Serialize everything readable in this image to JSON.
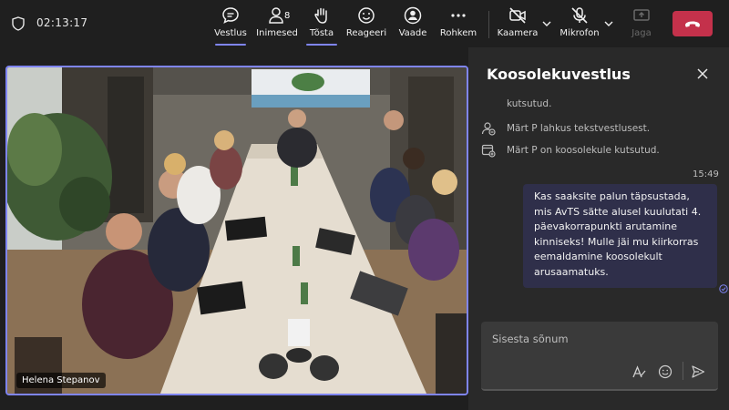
{
  "meeting": {
    "timer": "02:13:17"
  },
  "toolbar": {
    "chat_label": "Vestlus",
    "people_label": "Inimesed",
    "people_count": "8",
    "raise_label": "Tõsta",
    "react_label": "Reageeri",
    "view_label": "Vaade",
    "more_label": "Rohkem",
    "camera_label": "Kaamera",
    "mic_label": "Mikrofon",
    "share_label": "Jaga"
  },
  "colors": {
    "accent": "#7f85f5",
    "hangup": "#c4314b",
    "bubble": "#2f2f4a",
    "panel": "#292929",
    "background": "#1f1f1f"
  },
  "video": {
    "participant_name": "Helena Stepanov"
  },
  "chat": {
    "title": "Koosolekuvestlus",
    "truncated_prev": "kutsutud.",
    "system_messages": [
      {
        "text": "Märt P lahkus tekstvestlusest.",
        "icon": "person-leave-icon"
      },
      {
        "text": "Märt P on koosolekule kutsutud.",
        "icon": "calendar-invite-icon"
      }
    ],
    "message_time": "15:49",
    "message_text": "Kas saaksite palun täpsustada, mis AvTS sätte alusel kuulutati 4. päevakorrapunkti arutamine kinniseks! Mulle jäi mu kiirkorras eemaldamine koosolekult arusaamatuks.",
    "compose_placeholder": "Sisesta sõnum"
  }
}
